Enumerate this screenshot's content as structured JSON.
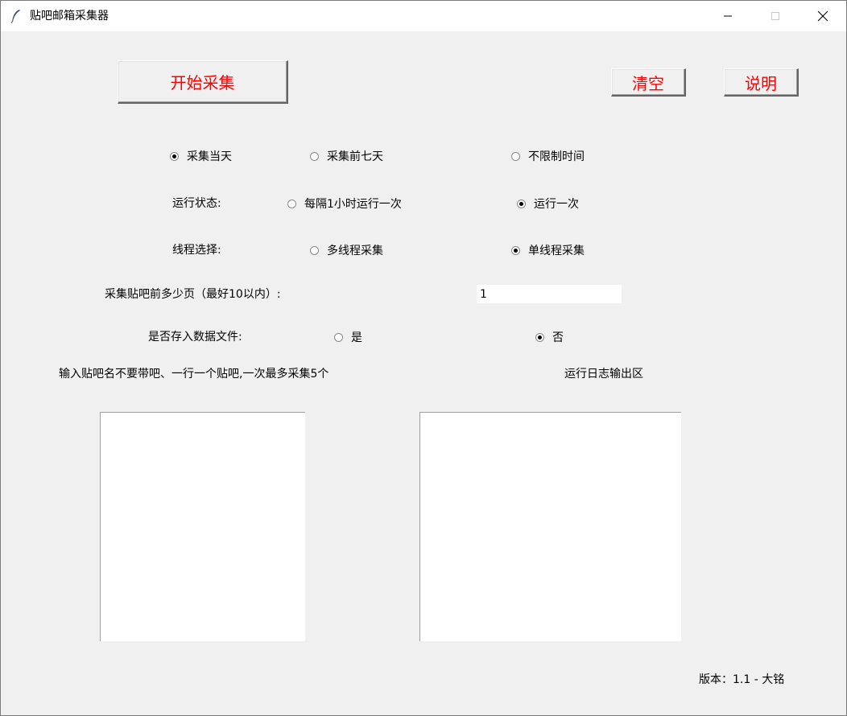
{
  "window": {
    "title": "贴吧邮箱采集器"
  },
  "buttons": {
    "start": "开始采集",
    "clear": "清空",
    "help": "说明"
  },
  "time_range": {
    "options": [
      "采集当天",
      "采集前七天",
      "不限制时间"
    ],
    "selected": 0
  },
  "run_mode": {
    "label": "运行状态:",
    "options": [
      "每隔1小时运行一次",
      "运行一次"
    ],
    "selected": 1
  },
  "thread_mode": {
    "label": "线程选择:",
    "options": [
      "多线程采集",
      "单线程采集"
    ],
    "selected": 1
  },
  "pages": {
    "label": "采集贴吧前多少页（最好10以内）:",
    "value": "1"
  },
  "save_file": {
    "label": "是否存入数据文件:",
    "options": [
      "是",
      "否"
    ],
    "selected": 1
  },
  "input_area": {
    "label": "输入贴吧名不要带吧、一行一个贴吧,一次最多采集5个",
    "value": ""
  },
  "log_area": {
    "label": "运行日志输出区",
    "value": ""
  },
  "footer": {
    "version": "版本：1.1 - 大铭"
  },
  "icons": {
    "app": "feather-icon",
    "minimize": "minimize-icon",
    "maximize": "maximize-icon",
    "close": "close-icon"
  }
}
